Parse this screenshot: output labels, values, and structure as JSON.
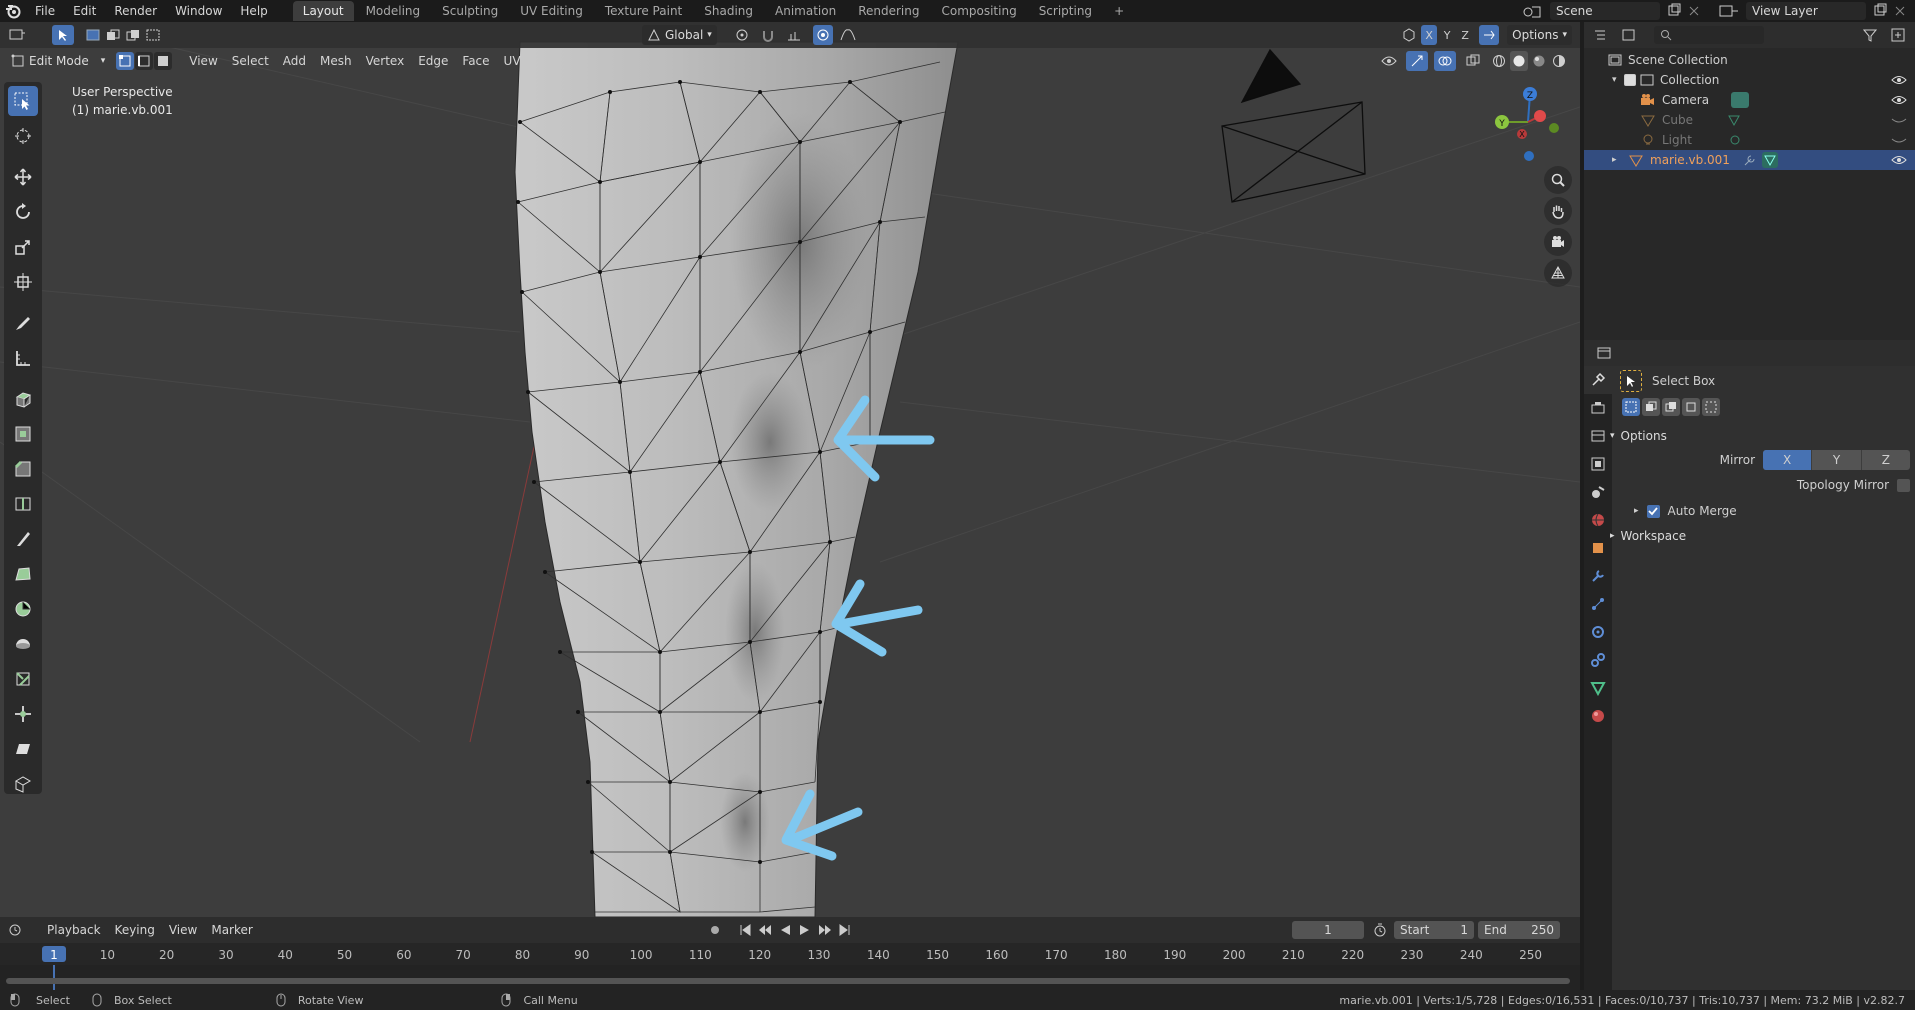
{
  "topbar": {
    "menus": [
      "File",
      "Edit",
      "Render",
      "Window",
      "Help"
    ],
    "workspaces": [
      "Layout",
      "Modeling",
      "Sculpting",
      "UV Editing",
      "Texture Paint",
      "Shading",
      "Animation",
      "Rendering",
      "Compositing",
      "Scripting"
    ],
    "active_workspace": "Layout",
    "add_tab": "+",
    "scene_label": "Scene",
    "view_layer_label": "View Layer"
  },
  "viewport_header": {
    "mode": "Edit Mode",
    "menus": [
      "View",
      "Select",
      "Add",
      "Mesh",
      "Vertex",
      "Edge",
      "Face",
      "UV"
    ],
    "orientation": "Global",
    "axis_x": "X",
    "axis_y": "Y",
    "axis_z": "Z",
    "options": "Options"
  },
  "viewport_info": {
    "perspective": "User Perspective",
    "object": "(1) marie.vb.001"
  },
  "gizmo": {
    "x": "X",
    "y": "Y",
    "z": "Z"
  },
  "outliner": {
    "root": "Scene Collection",
    "items": [
      {
        "label": "Collection",
        "icon": "collection-icon",
        "dim": false,
        "selected": false
      },
      {
        "label": "Camera",
        "icon": "camera-icon",
        "dim": false,
        "selected": false
      },
      {
        "label": "Cube",
        "icon": "mesh-icon",
        "dim": true,
        "selected": false
      },
      {
        "label": "Light",
        "icon": "light-icon",
        "dim": true,
        "selected": false
      },
      {
        "label": "marie.vb.001",
        "icon": "mesh-icon",
        "dim": false,
        "selected": true
      }
    ]
  },
  "properties": {
    "tool_name": "Select Box",
    "options_title": "Options",
    "mirror_label": "Mirror",
    "mirror_x": "X",
    "mirror_y": "Y",
    "mirror_z": "Z",
    "topology_mirror": "Topology Mirror",
    "auto_merge": "Auto Merge",
    "workspace": "Workspace"
  },
  "timeline": {
    "menus": [
      "Playback",
      "Keying",
      "View",
      "Marker"
    ],
    "current_frame": "1",
    "start_label": "Start",
    "start_value": "1",
    "end_label": "End",
    "end_value": "250",
    "ruler": [
      "1",
      "10",
      "20",
      "30",
      "40",
      "50",
      "60",
      "70",
      "80",
      "90",
      "100",
      "110",
      "120",
      "130",
      "140",
      "150",
      "160",
      "170",
      "180",
      "190",
      "200",
      "210",
      "220",
      "230",
      "240",
      "250"
    ]
  },
  "statusbar": {
    "select": "Select",
    "box_select": "Box Select",
    "rotate_view": "Rotate View",
    "call_menu": "Call Menu",
    "stats": "marie.vb.001 | Verts:1/5,728 | Edges:0/16,531 | Faces:0/10,737 | Tris:10,737 | Mem: 73.2 MiB | v2.82.7"
  },
  "colors": {
    "accent": "#4772b3",
    "annotation_arrow": "#7fc8f0",
    "viewport_bg": "#3d3d3d",
    "mesh": "#b9b9b9"
  }
}
